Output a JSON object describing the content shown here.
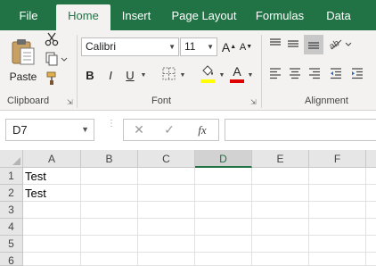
{
  "tabs": [
    {
      "label": "File",
      "active": false
    },
    {
      "label": "Home",
      "active": true
    },
    {
      "label": "Insert",
      "active": false
    },
    {
      "label": "Page Layout",
      "active": false
    },
    {
      "label": "Formulas",
      "active": false
    },
    {
      "label": "Data",
      "active": false
    }
  ],
  "ribbon": {
    "clipboard": {
      "label": "Clipboard",
      "paste_label": "Paste"
    },
    "font": {
      "label": "Font",
      "font_name": "Calibri",
      "font_size": "11",
      "grow_label": "A",
      "shrink_label": "A",
      "bold_label": "B",
      "italic_label": "I",
      "underline_label": "U",
      "font_color_label": "A",
      "fill_color": "#ffff00",
      "font_color": "#e00000"
    },
    "alignment": {
      "label": "Alignment"
    }
  },
  "formula_bar": {
    "name_box": "D7",
    "fx_label": "fx",
    "formula_value": ""
  },
  "grid": {
    "columns": [
      "A",
      "B",
      "C",
      "D",
      "E",
      "F"
    ],
    "selected_column": "D",
    "rows": [
      "1",
      "2",
      "3",
      "4",
      "5",
      "6"
    ],
    "cells": {
      "A1": "Test",
      "A2": "Test"
    }
  },
  "colors": {
    "accent": "#217346",
    "ribbon_bg": "#f3f2f1"
  }
}
